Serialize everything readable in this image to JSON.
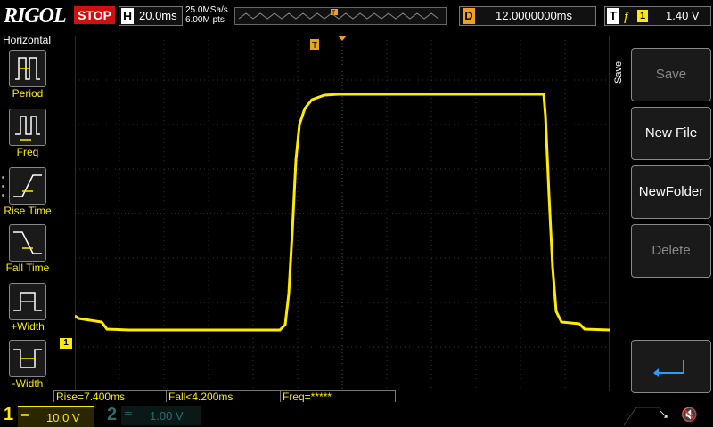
{
  "brand": "RIGOL",
  "run_state": "STOP",
  "horizontal": {
    "letter": "H",
    "timebase": "20.0ms",
    "sample_rate": "25.0MSa/s",
    "memory_depth": "6.00M pts"
  },
  "delay": {
    "letter": "D",
    "value": "12.0000000ms"
  },
  "trigger": {
    "letter": "T",
    "slope_symbol": "ƒ",
    "source": "1",
    "level": "1.40 V"
  },
  "left_menu": {
    "title": "Horizontal",
    "items": [
      {
        "label": "Period"
      },
      {
        "label": "Freq"
      },
      {
        "label": "Rise Time"
      },
      {
        "label": "Fall Time"
      },
      {
        "label": "+Width"
      },
      {
        "label": "-Width"
      }
    ]
  },
  "right_menu": {
    "title": "Save",
    "items": [
      {
        "label": "Save",
        "enabled": false
      },
      {
        "label": "New File",
        "enabled": true
      },
      {
        "label": "NewFolder",
        "enabled": true
      },
      {
        "label": "Delete",
        "enabled": false
      }
    ]
  },
  "measurements": {
    "rise": "Rise=7.400ms",
    "fall": "Fall<4.200ms",
    "freq": "Freq=*****"
  },
  "markers": {
    "trigger": "T",
    "ch1": "1"
  },
  "channels": [
    {
      "number": "1",
      "symbol": "═",
      "scale": "10.0 V",
      "active": true
    },
    {
      "number": "2",
      "symbol": "═",
      "scale": "1.00 V",
      "active": false
    }
  ],
  "colors": {
    "ch1": "#ffea00",
    "trigger": "#f0a020",
    "stop": "#d01010"
  },
  "icons": {
    "usb": "usb-icon",
    "sound": "speaker-muted-icon"
  }
}
